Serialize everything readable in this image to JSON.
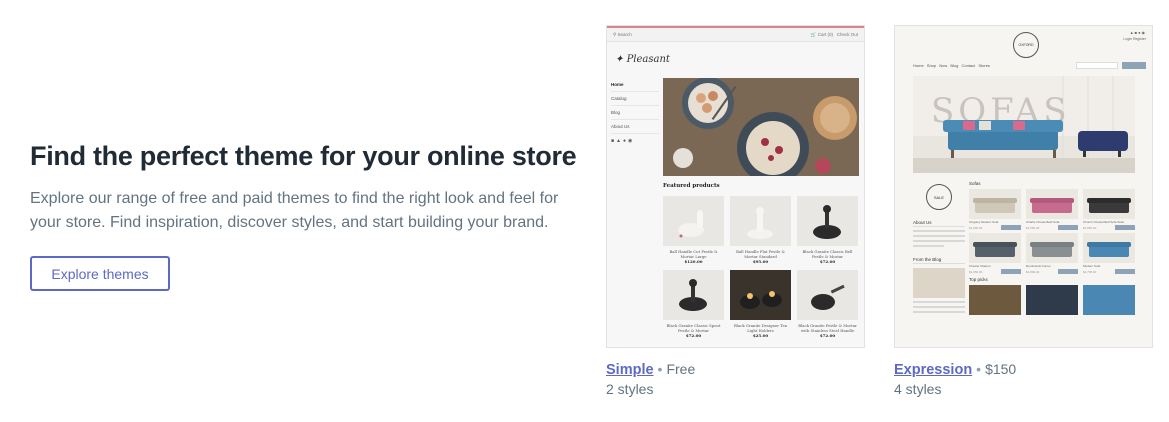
{
  "hero": {
    "title": "Find the perfect theme for your online store",
    "description": "Explore our range of free and paid themes to find the right look and feel for your store. Find inspiration, discover styles, and start building your brand.",
    "button_label": "Explore themes"
  },
  "themes": [
    {
      "name": "Simple",
      "price": "Free",
      "styles": "2 styles",
      "preview": {
        "search": "Search",
        "cart": "Cart (0)",
        "checkout": "Check Out",
        "logo": "Pleasant",
        "nav": [
          "Home",
          "Catalog",
          "Blog",
          "About Us"
        ],
        "section_title": "Featured products",
        "products": [
          {
            "title": "Ball Handle Cut Pestle & Mortar Large",
            "price": "$120.00"
          },
          {
            "title": "Ball Handle Flat Pestle & Mortar Standard",
            "price": "$95.00"
          },
          {
            "title": "Black Granite Classic Bell Pestle & Mortar",
            "price": "$72.00"
          },
          {
            "title": "Black Granite Classic Spout Pestle & Mortar",
            "price": "$72.00"
          },
          {
            "title": "Black Granite Designer Tea Light Holders",
            "price": "$25.00"
          },
          {
            "title": "Black Granite Pestle & Mortar with Stainless Steel Handle",
            "price": "$72.00"
          }
        ]
      }
    },
    {
      "name": "Expression",
      "price": "$150",
      "styles": "4 styles",
      "preview": {
        "logo": "OXFORD",
        "login": "Login  Register",
        "nav": "Home  Shop Now  Blog  Contact  Stores",
        "hero_word": "SOFAS",
        "sale": "SALE",
        "about": "About Us",
        "blog": "From the Blog",
        "sofas_heading": "Sofas",
        "top_picks": "Top picks",
        "products": [
          {
            "title": "Kingsley Modern Sofa",
            "price": "$1,695.00"
          },
          {
            "title": "Charlie Chesterfield Sofa",
            "price": "$1,550.00"
          },
          {
            "title": "Church Chesterfield Sofa Suite",
            "price": "$1,850.00"
          },
          {
            "title": "Chester Modern",
            "price": "$1,650.00"
          },
          {
            "title": "Rembrandt Corner",
            "price": "$1,899.00"
          },
          {
            "title": "Modern Sofa",
            "price": "$2,795.00"
          }
        ]
      }
    }
  ],
  "colors": {
    "accent": "#5c6ac4",
    "heading": "#212b36",
    "body": "#637381"
  }
}
